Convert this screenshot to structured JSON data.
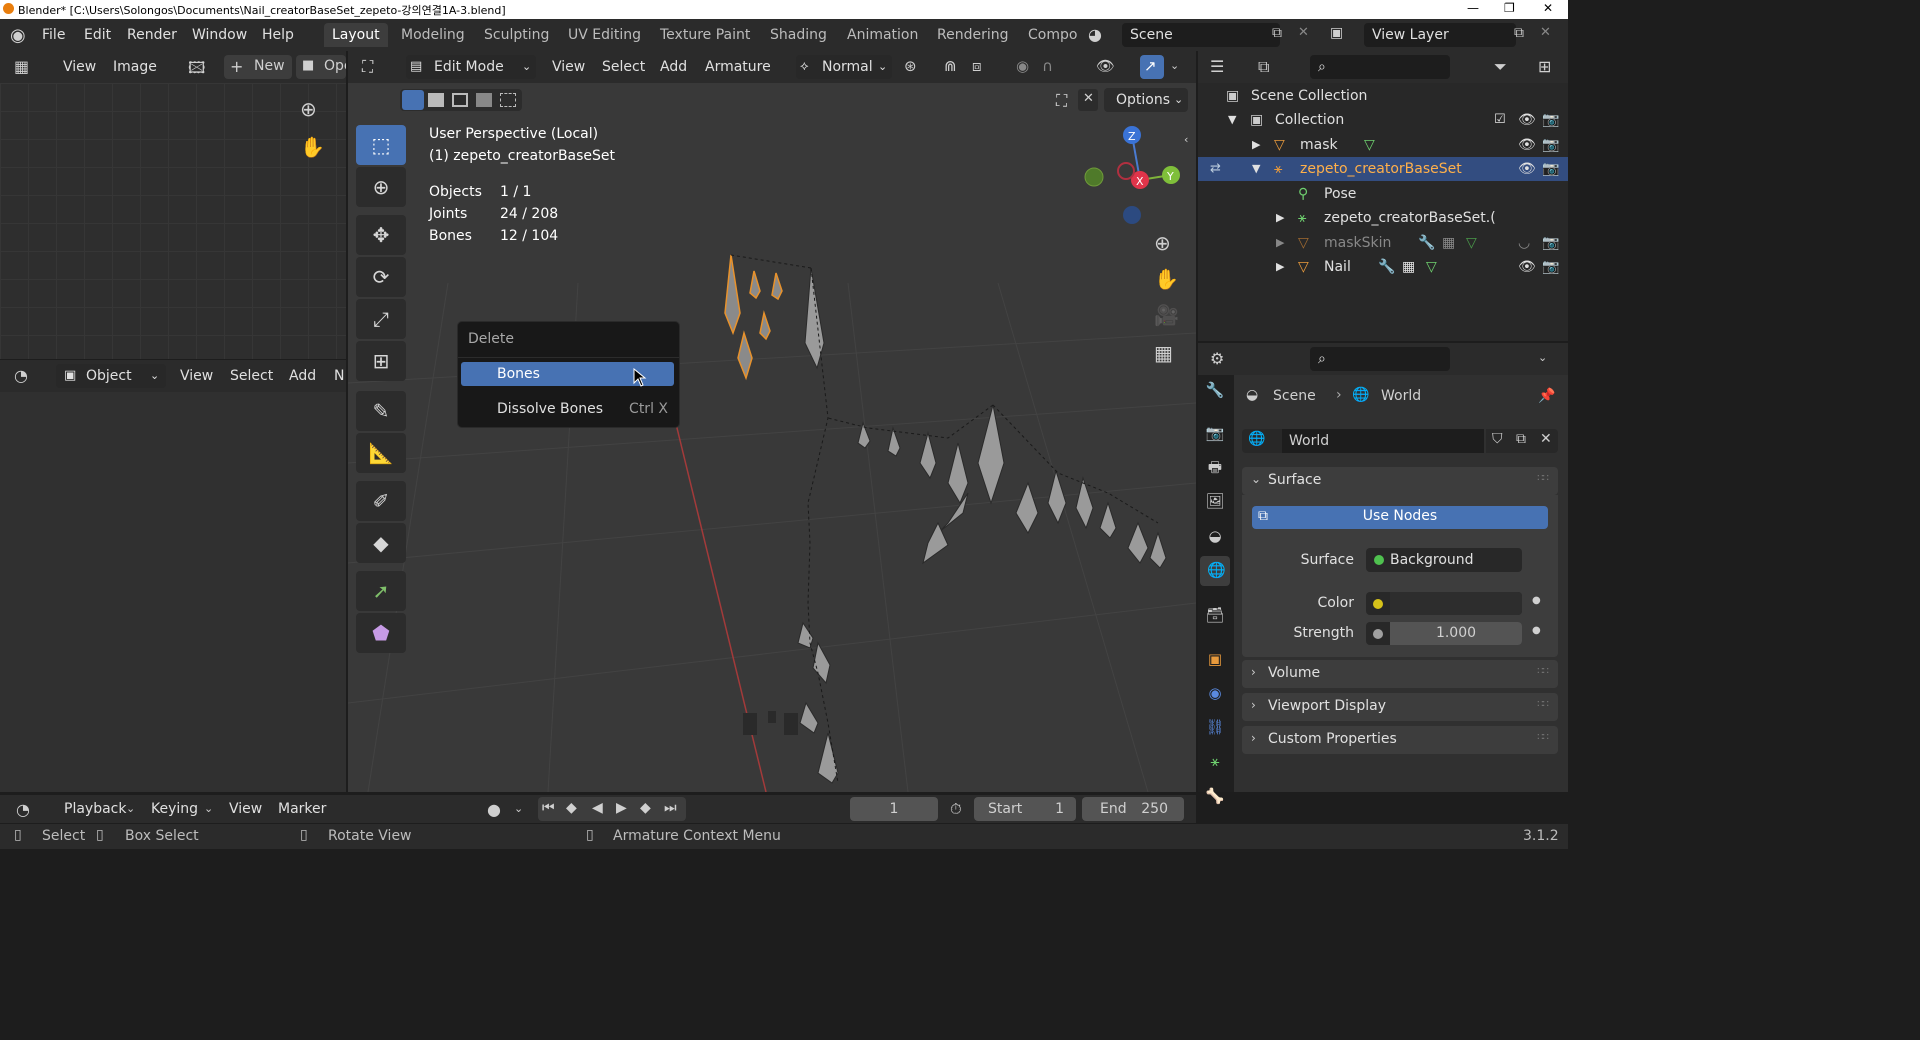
{
  "titlebar": {
    "title": "Blender* [C:\\Users\\Solongos\\Documents\\Nail_creatorBaseSet_zepeto-강의연결1A-3.blend]",
    "minimize": "—",
    "restore": "❐",
    "close": "✕"
  },
  "menubar": {
    "items": [
      "File",
      "Edit",
      "Render",
      "Window",
      "Help"
    ],
    "workspaces": [
      "Layout",
      "Modeling",
      "Sculpting",
      "UV Editing",
      "Texture Paint",
      "Shading",
      "Animation",
      "Rendering",
      "Compo"
    ],
    "scene": "Scene",
    "view_layer": "View Layer"
  },
  "image_editor": {
    "menus": [
      "View",
      "Image"
    ],
    "new_label": "New",
    "open_label": "Ope"
  },
  "left_lower": {
    "mode": "Object",
    "menus": [
      "View",
      "Select",
      "Add",
      "N"
    ]
  },
  "viewport_header": {
    "mode": "Edit Mode",
    "menus": [
      "View",
      "Select",
      "Add",
      "Armature"
    ],
    "orientation": "Normal",
    "options": "Options"
  },
  "viewport_overlay": {
    "perspective": "User Perspective (Local)",
    "object": "(1) zepeto_creatorBaseSet",
    "stats": [
      {
        "label": "Objects",
        "value": "1 / 1"
      },
      {
        "label": "Joints",
        "value": "24 / 208"
      },
      {
        "label": "Bones",
        "value": "12 / 104"
      }
    ],
    "gizmo": {
      "x": "X",
      "y": "Y",
      "z": "Z"
    }
  },
  "delete_menu": {
    "title": "Delete",
    "items": [
      {
        "label": "Bones",
        "shortcut": ""
      },
      {
        "label": "Dissolve Bones",
        "shortcut": "Ctrl X"
      }
    ]
  },
  "outliner": {
    "rows": [
      {
        "label": "Scene Collection"
      },
      {
        "label": "Collection"
      },
      {
        "label": "mask"
      },
      {
        "label": "zepeto_creatorBaseSet"
      },
      {
        "label": "Pose"
      },
      {
        "label": "zepeto_creatorBaseSet.("
      },
      {
        "label": "maskSkin"
      },
      {
        "label": "Nail"
      }
    ]
  },
  "properties": {
    "breadcrumb": {
      "scene": "Scene",
      "world": "World"
    },
    "world_name": "World",
    "surface_section": "Surface",
    "use_nodes": "Use Nodes",
    "surface_label": "Surface",
    "surface_value": "Background",
    "color_label": "Color",
    "strength_label": "Strength",
    "strength_value": "1.000",
    "sections": [
      "Volume",
      "Viewport Display",
      "Custom Properties"
    ],
    "colors": {
      "surface_dot": "#4fc14f",
      "color_dot": "#d6c21a"
    }
  },
  "timeline": {
    "menus": [
      "Playback",
      "Keying",
      "View",
      "Marker"
    ],
    "current_frame": "1",
    "start_label": "Start",
    "start_value": "1",
    "end_label": "End",
    "end_value": "250"
  },
  "statusbar": {
    "items": [
      "Select",
      "Box Select",
      "Rotate View",
      "Armature Context Menu"
    ],
    "version": "3.1.2"
  },
  "colors": {
    "accent": "#4772b3",
    "selected_row": "#334d80",
    "active_bone": "#e8922c"
  }
}
